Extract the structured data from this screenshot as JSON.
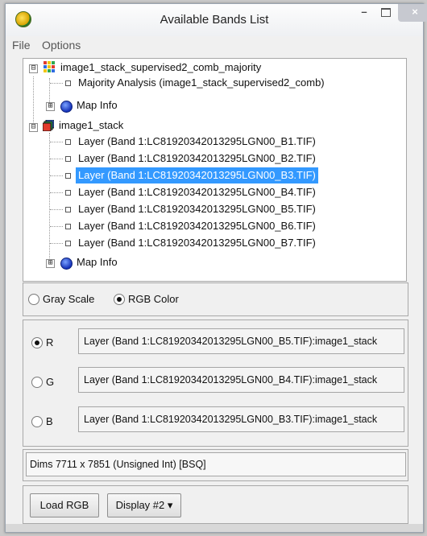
{
  "window": {
    "title": "Available Bands List",
    "controls": {
      "minimize": "–",
      "close": "×"
    }
  },
  "menu": {
    "items": [
      "File",
      "Options"
    ]
  },
  "tree": {
    "group1": {
      "name": "image1_stack_supervised2_comb_majority",
      "expander": "⊟",
      "children": [
        "Majority Analysis (image1_stack_supervised2_comb)"
      ],
      "map_info": "Map Info",
      "map_info_expander": "⊞"
    },
    "group2": {
      "name": "image1_stack",
      "expander": "⊟",
      "bands": [
        "Layer (Band 1:LC81920342013295LGN00_B1.TIF)",
        "Layer (Band 1:LC81920342013295LGN00_B2.TIF)",
        "Layer (Band 1:LC81920342013295LGN00_B3.TIF)",
        "Layer (Band 1:LC81920342013295LGN00_B4.TIF)",
        "Layer (Band 1:LC81920342013295LGN00_B5.TIF)",
        "Layer (Band 1:LC81920342013295LGN00_B6.TIF)",
        "Layer (Band 1:LC81920342013295LGN00_B7.TIF)"
      ],
      "selected_band_index": 2,
      "map_info": "Map Info",
      "map_info_expander": "⊞"
    }
  },
  "mode": {
    "options": [
      "Gray Scale",
      "RGB Color"
    ],
    "selected": "RGB Color"
  },
  "rgb": {
    "selected_channel": "R",
    "channels": [
      {
        "label": "R",
        "value": "Layer (Band 1:LC81920342013295LGN00_B5.TIF):image1_stack"
      },
      {
        "label": "G",
        "value": "Layer (Band 1:LC81920342013295LGN00_B4.TIF):image1_stack"
      },
      {
        "label": "B",
        "value": "Layer (Band 1:LC81920342013295LGN00_B3.TIF):image1_stack"
      }
    ]
  },
  "dims": {
    "label": "Dims",
    "value": "7711 x 7851 (Unsigned Int) [BSQ]"
  },
  "buttons": {
    "load": "Load RGB",
    "display": "Display #2",
    "display_arrow": "▾"
  },
  "colors": {
    "selection": "#3399ff",
    "globe": "#1532b8"
  }
}
